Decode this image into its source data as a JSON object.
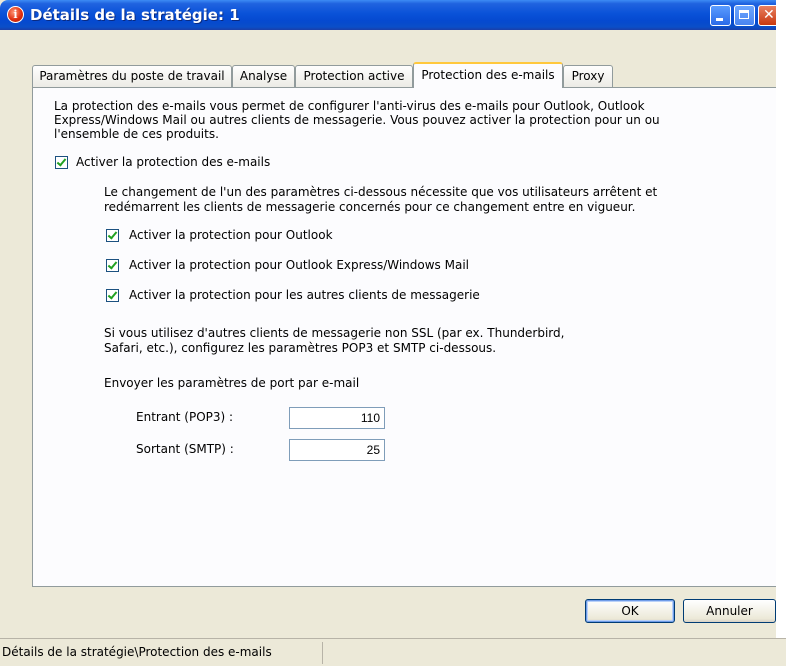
{
  "window": {
    "title": "Détails de la stratégie:  1",
    "icon": "info-icon"
  },
  "tabs": [
    {
      "label": "Paramètres du poste de travail",
      "active": false
    },
    {
      "label": "Analyse",
      "active": false
    },
    {
      "label": "Protection active",
      "active": false
    },
    {
      "label": "Protection des e-mails",
      "active": true
    },
    {
      "label": "Proxy",
      "active": false
    }
  ],
  "panel": {
    "intro_lines": [
      "La protection des e-mails vous permet de configurer l'anti-virus des e-mails pour Outlook, Outlook",
      "Express/Windows Mail ou autres clients de messagerie. Vous pouvez activer la protection pour un ou",
      "l'ensemble de ces produits."
    ],
    "enable_email_protection": {
      "label": "Activer la protection des e-mails",
      "checked": true
    },
    "restart_note_lines": [
      "Le changement de l'un des paramètres ci-dessous nécessite que vos utilisateurs arrêtent et",
      "redémarrent les clients de messagerie concernés pour ce changement entre en vigueur."
    ],
    "options": [
      {
        "label": "Activer la protection pour Outlook",
        "checked": true
      },
      {
        "label": "Activer la protection pour Outlook Express/Windows Mail",
        "checked": true
      },
      {
        "label": "Activer la protection pour les autres clients de messagerie",
        "checked": true
      }
    ],
    "ssl_note_lines": [
      "Si vous utilisez d'autres clients de messagerie non SSL (par ex. Thunderbird,",
      "Safari, etc.), configurez les paramètres POP3 et SMTP ci-dessous."
    ],
    "port_heading": "Envoyer les paramètres de port par e-mail",
    "incoming": {
      "label": "Entrant (POP3) :",
      "value": "110"
    },
    "outgoing": {
      "label": "Sortant (SMTP) :",
      "value": "25"
    }
  },
  "buttons": {
    "ok": "OK",
    "cancel": "Annuler"
  },
  "statusbar": {
    "text": "Détails de la stratégie\\Protection des e-mails"
  }
}
